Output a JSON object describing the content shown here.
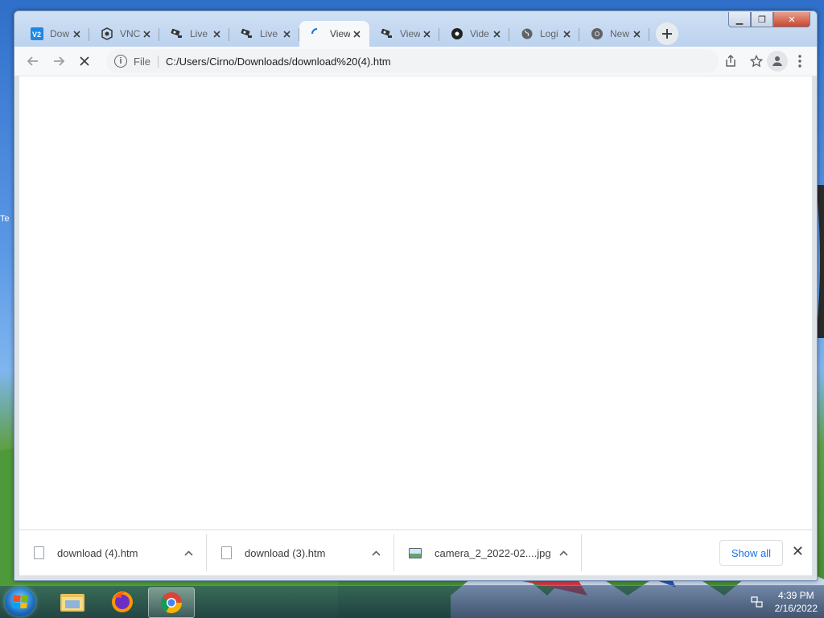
{
  "desktop": {
    "partial_label": "Te"
  },
  "browser": {
    "tabs": [
      {
        "title": "Dow",
        "icon": "v2-app-icon",
        "active": false
      },
      {
        "title": "VNC",
        "icon": "vnc-icon",
        "active": false
      },
      {
        "title": "Live",
        "icon": "camera-icon",
        "active": false
      },
      {
        "title": "Live",
        "icon": "camera-icon",
        "active": false
      },
      {
        "title": "View",
        "icon": "loading-spinner-icon",
        "active": true
      },
      {
        "title": "View",
        "icon": "camera-icon",
        "active": false
      },
      {
        "title": "Vide",
        "icon": "video-dot-icon",
        "active": false
      },
      {
        "title": "Logi",
        "icon": "globe-icon",
        "active": false
      },
      {
        "title": "New",
        "icon": "chrome-icon",
        "active": false
      }
    ],
    "toolbar": {
      "site_chip": "File",
      "url": "C:/Users/Cirno/Downloads/download%20(4).htm"
    },
    "downloads": {
      "items": [
        {
          "name": "download (4).htm",
          "type": "file"
        },
        {
          "name": "download (3).htm",
          "type": "file"
        },
        {
          "name": "camera_2_2022-02....jpg",
          "type": "image"
        }
      ],
      "show_all_label": "Show all"
    }
  },
  "taskbar": {
    "apps": [
      "file-explorer-icon",
      "firefox-icon",
      "chrome-icon"
    ],
    "active_app": "chrome-icon",
    "time": "4:39 PM",
    "date": "2/16/2022"
  }
}
